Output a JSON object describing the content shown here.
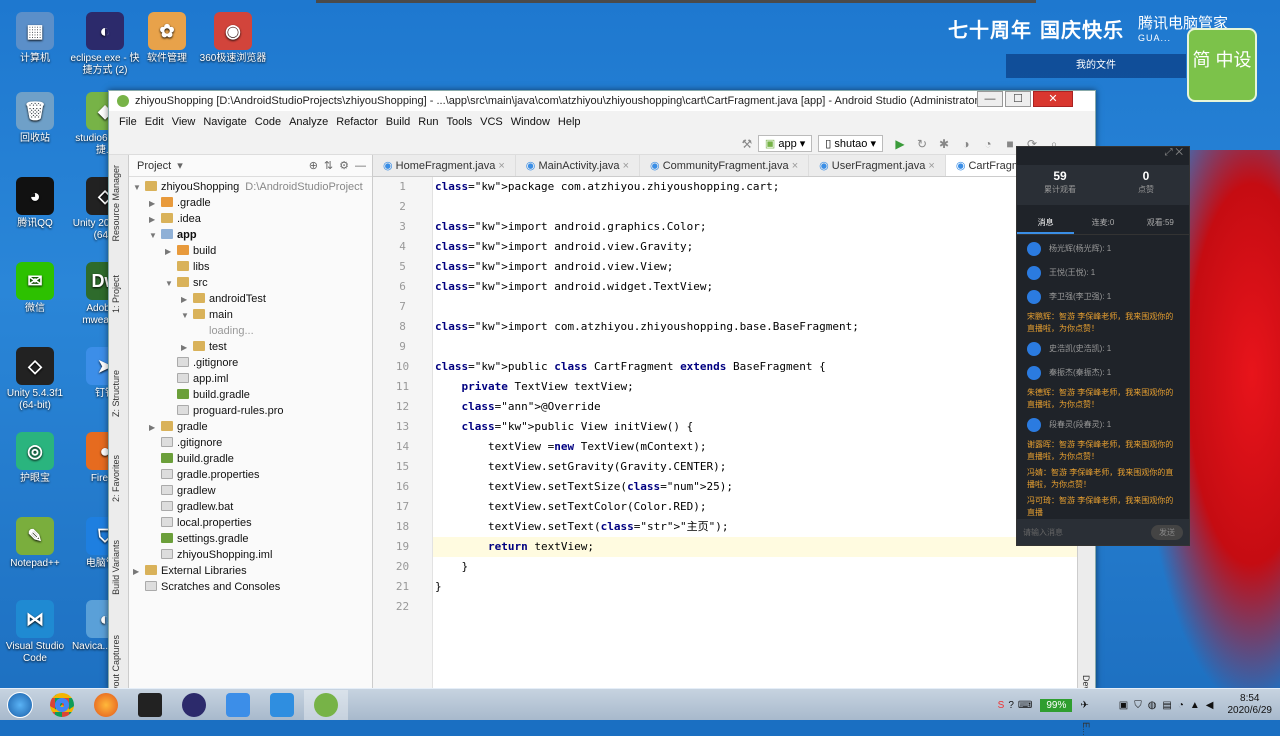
{
  "desktop": {
    "icons": [
      {
        "label": "计算机",
        "glyph": "▦",
        "color": "#5b8fc9"
      },
      {
        "label": "eclipse.exe - 快捷方式 (2)",
        "glyph": "◐",
        "color": "#2c2a6b"
      },
      {
        "label": "软件管理",
        "glyph": "✿",
        "color": "#e8a24a"
      },
      {
        "label": "360极速浏览器",
        "glyph": "◉",
        "color": "#d2443b"
      },
      {
        "label": "回收站",
        "glyph": "🗑",
        "color": "#6fa0c8"
      },
      {
        "label": "studio6... - 快捷...",
        "glyph": "◆",
        "color": "#77b347"
      },
      {
        "label": "腾讯QQ",
        "glyph": "◕",
        "color": "#111"
      },
      {
        "label": "Unity 20... .3f1 (64...",
        "glyph": "◇",
        "color": "#222"
      },
      {
        "label": "微信",
        "glyph": "✉",
        "color": "#2dc100"
      },
      {
        "label": "Adobe... mweave...",
        "glyph": "Dw",
        "color": "#2e6b2c"
      },
      {
        "label": "Unity 5.4.3f1 (64-bit)",
        "glyph": "◇",
        "color": "#222"
      },
      {
        "label": "钉钉",
        "glyph": "➤",
        "color": "#3c8ee8"
      },
      {
        "label": "护眼宝",
        "glyph": "◎",
        "color": "#2ab47e"
      },
      {
        "label": "Firef...",
        "glyph": "●",
        "color": "#e66b1f"
      },
      {
        "label": "Notepad++",
        "glyph": "✎",
        "color": "#7aae3d"
      },
      {
        "label": "电脑管...",
        "glyph": "⛉",
        "color": "#1e7fe0"
      },
      {
        "label": "Visual Studio Code",
        "glyph": "⋈",
        "color": "#1f8ad2"
      },
      {
        "label": "Navica... mium",
        "glyph": "◐",
        "color": "#5aa0d8"
      }
    ],
    "banner": "七十周年 国庆快乐",
    "guard_title": "腾讯电脑管家",
    "guard_sub": "GUA...",
    "green_text": "简 中设",
    "my_files": "我的文件"
  },
  "window": {
    "title": "zhiyouShopping [D:\\AndroidStudioProjects\\zhiyouShopping] - ...\\app\\src\\main\\java\\com\\atzhiyou\\zhiyoushopping\\cart\\CartFragment.java [app] - Android Studio (Administrator)",
    "minimize": "—",
    "maximize": "☐",
    "close": "✕"
  },
  "menu": [
    "File",
    "Edit",
    "View",
    "Navigate",
    "Code",
    "Analyze",
    "Refactor",
    "Build",
    "Run",
    "Tools",
    "VCS",
    "Window",
    "Help"
  ],
  "toolbar": {
    "run_config": "app",
    "device": "shutao"
  },
  "left_tabs": [
    "Resource Manager",
    "1: Project",
    "Z: Structure",
    "2: Favorites",
    "Build Variants",
    "Layout Captures"
  ],
  "project": {
    "header": "Project",
    "tree": [
      {
        "indent": 0,
        "arrow": "▼",
        "icon": "folder",
        "label": "zhiyouShopping",
        "extra": "D:\\AndroidStudioProject"
      },
      {
        "indent": 1,
        "arrow": "▶",
        "icon": "ofolder",
        "label": ".gradle"
      },
      {
        "indent": 1,
        "arrow": "▶",
        "icon": "folder",
        "label": ".idea"
      },
      {
        "indent": 1,
        "arrow": "▼",
        "icon": "bfolder",
        "label": "app",
        "bold": true
      },
      {
        "indent": 2,
        "arrow": "▶",
        "icon": "ofolder",
        "label": "build"
      },
      {
        "indent": 2,
        "arrow": "",
        "icon": "folder",
        "label": "libs"
      },
      {
        "indent": 2,
        "arrow": "▼",
        "icon": "folder",
        "label": "src"
      },
      {
        "indent": 3,
        "arrow": "▶",
        "icon": "folder",
        "label": "androidTest"
      },
      {
        "indent": 3,
        "arrow": "▼",
        "icon": "folder",
        "label": "main"
      },
      {
        "indent": 4,
        "arrow": "",
        "icon": "",
        "label": "loading...",
        "muted": true
      },
      {
        "indent": 3,
        "arrow": "▶",
        "icon": "folder",
        "label": "test"
      },
      {
        "indent": 2,
        "arrow": "",
        "icon": "file",
        "label": ".gitignore"
      },
      {
        "indent": 2,
        "arrow": "",
        "icon": "file",
        "label": "app.iml"
      },
      {
        "indent": 2,
        "arrow": "",
        "icon": "grad",
        "label": "build.gradle"
      },
      {
        "indent": 2,
        "arrow": "",
        "icon": "file",
        "label": "proguard-rules.pro"
      },
      {
        "indent": 1,
        "arrow": "▶",
        "icon": "folder",
        "label": "gradle"
      },
      {
        "indent": 1,
        "arrow": "",
        "icon": "file",
        "label": ".gitignore"
      },
      {
        "indent": 1,
        "arrow": "",
        "icon": "grad",
        "label": "build.gradle"
      },
      {
        "indent": 1,
        "arrow": "",
        "icon": "file",
        "label": "gradle.properties"
      },
      {
        "indent": 1,
        "arrow": "",
        "icon": "file",
        "label": "gradlew"
      },
      {
        "indent": 1,
        "arrow": "",
        "icon": "file",
        "label": "gradlew.bat"
      },
      {
        "indent": 1,
        "arrow": "",
        "icon": "file",
        "label": "local.properties"
      },
      {
        "indent": 1,
        "arrow": "",
        "icon": "grad",
        "label": "settings.gradle"
      },
      {
        "indent": 1,
        "arrow": "",
        "icon": "file",
        "label": "zhiyouShopping.iml"
      },
      {
        "indent": 0,
        "arrow": "▶",
        "icon": "folder",
        "label": "External Libraries"
      },
      {
        "indent": 0,
        "arrow": "",
        "icon": "file",
        "label": "Scratches and Consoles"
      }
    ]
  },
  "editor": {
    "tabs": [
      "HomeFragment.java",
      "MainActivity.java",
      "CommunityFragment.java",
      "UserFragment.java",
      "CartFragment."
    ],
    "lines": [
      "package com.atzhiyou.zhiyoushopping.cart;",
      "",
      "import android.graphics.Color;",
      "import android.view.Gravity;",
      "import android.view.View;",
      "import android.widget.TextView;",
      "",
      "import com.atzhiyou.zhiyoushopping.base.BaseFragment;",
      "",
      "public class CartFragment extends BaseFragment {",
      "    private TextView textView;",
      "    @Override",
      "    public View initView() {",
      "        textView =new TextView(mContext);",
      "        textView.setGravity(Gravity.CENTER);",
      "        textView.setTextSize(25);",
      "        textView.setTextColor(Color.RED);",
      "        textView.setText(\"主页\");",
      "        return textView;",
      "    }",
      "}",
      ""
    ],
    "highlight_line": 19
  },
  "right_tabs": [
    "Device File E..."
  ],
  "chat": {
    "stat1_value": "59",
    "stat1_label": "累计观看",
    "stat2_value": "0",
    "stat2_label": "点赞",
    "tabs": [
      "消息",
      "连麦:0",
      "观看:59"
    ],
    "messages": [
      {
        "type": "user",
        "text": "杨光辉(杨光辉): 1"
      },
      {
        "type": "user",
        "text": "王悦(王悦): 1"
      },
      {
        "type": "user",
        "text": "李卫强(李卫强): 1"
      },
      {
        "type": "sys",
        "text": "宋鹏辉：智游 李保峰老师，我来围观你的直播啦，为你点赞！"
      },
      {
        "type": "user",
        "text": "史浩凯(史浩凯): 1"
      },
      {
        "type": "user",
        "text": "秦振杰(秦振杰): 1"
      },
      {
        "type": "sys",
        "text": "朱德辉：智游 李保峰老师，我来围观你的直播啦，为你点赞！"
      },
      {
        "type": "user",
        "text": "段春灵(段春灵): 1"
      },
      {
        "type": "sys",
        "text": "谢露晖：智游 李保峰老师，我来围观你的直播啦，为你点赞！"
      },
      {
        "type": "sys",
        "text": "冯婧：智游 李保峰老师，我来围观你的直播啦，为你点赞！"
      },
      {
        "type": "sys",
        "text": "冯可琦：智游 李保峰老师，我来围观你的直播"
      }
    ],
    "input_placeholder": "请输入消息",
    "send": "发送"
  },
  "taskbar": {
    "battery": "99%",
    "time": "8:54",
    "date": "2020/6/29"
  }
}
